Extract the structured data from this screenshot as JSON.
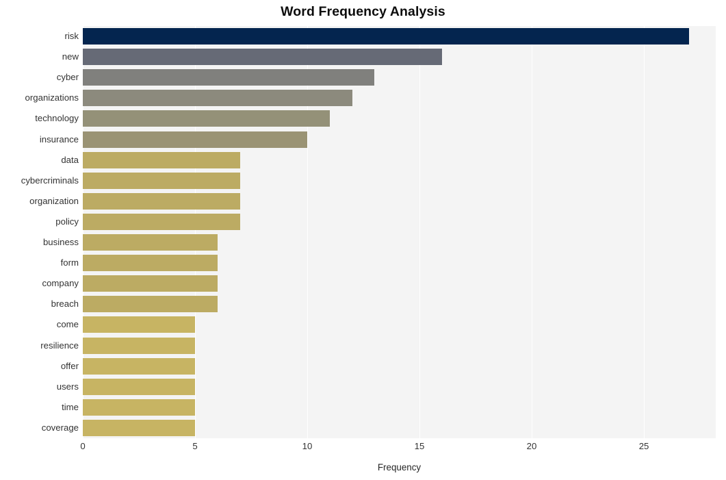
{
  "chart_data": {
    "type": "bar",
    "orientation": "horizontal",
    "title": "Word Frequency Analysis",
    "xlabel": "Frequency",
    "ylabel": "",
    "xlim": [
      0,
      28.2
    ],
    "xticks": [
      0,
      5,
      10,
      15,
      20,
      25
    ],
    "xticklabels": [
      "0",
      "5",
      "10",
      "15",
      "20",
      "25"
    ],
    "grid": "vertical-white",
    "legend": "none",
    "categories": [
      "risk",
      "new",
      "cyber",
      "organizations",
      "technology",
      "insurance",
      "data",
      "cybercriminals",
      "organization",
      "policy",
      "business",
      "form",
      "company",
      "breach",
      "come",
      "resilience",
      "offer",
      "users",
      "time",
      "coverage"
    ],
    "values": [
      27,
      16,
      13,
      12,
      11,
      10,
      7,
      7,
      7,
      7,
      6,
      6,
      6,
      6,
      5,
      5,
      5,
      5,
      5,
      5
    ],
    "bar_colors": [
      "#04254f",
      "#666a76",
      "#80807d",
      "#8c8a7d",
      "#949178",
      "#9a9374",
      "#bcab63",
      "#bcab63",
      "#bcab63",
      "#bcab63",
      "#bcab63",
      "#bcab63",
      "#bcab63",
      "#bcab63",
      "#c7b463",
      "#c7b463",
      "#c7b463",
      "#c7b463",
      "#c7b463",
      "#c7b463"
    ],
    "plot_background": "#f4f4f4",
    "figure_background": "#ffffff",
    "gridline_color": "#ffffff",
    "tick_label_color": "#333333"
  }
}
